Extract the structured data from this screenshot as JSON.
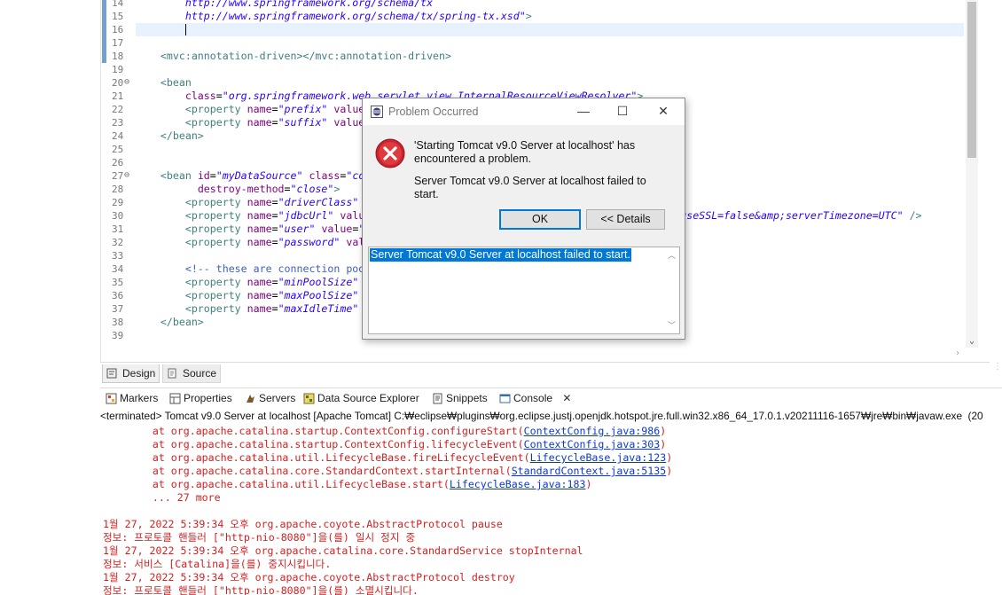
{
  "editor": {
    "lines": [
      {
        "n": "14",
        "mark": true,
        "fold": false,
        "html": "        <span class=\"val\">http://www.springframework.org/schema/tx</span>"
      },
      {
        "n": "15",
        "mark": true,
        "fold": false,
        "html": "        <span class=\"val\">http://www.springframework.org/schema/tx/spring-tx.xsd\"</span><span class=\"tag\">&gt;</span>"
      },
      {
        "n": "16",
        "mark": true,
        "fold": false,
        "cur": true,
        "html": "        <span class=\"caret\"></span>"
      },
      {
        "n": "17",
        "mark": true,
        "fold": false,
        "html": ""
      },
      {
        "n": "18",
        "mark": true,
        "fold": false,
        "html": "    <span class=\"tag\">&lt;mvc:annotation-driven&gt;&lt;/mvc:annotation-driven&gt;</span>"
      },
      {
        "n": "19",
        "mark": false,
        "fold": false,
        "html": ""
      },
      {
        "n": "20",
        "mark": false,
        "fold": true,
        "html": "    <span class=\"tag\">&lt;bean</span>"
      },
      {
        "n": "21",
        "mark": false,
        "fold": false,
        "html": "        <span class=\"attr\">class</span>=<span class=\"val\">\"org.springframework.web.servlet.view.InternalResourceViewResolver\"</span><span class=\"tag\">&gt;</span>"
      },
      {
        "n": "22",
        "mark": false,
        "fold": false,
        "html": "        <span class=\"tag\">&lt;property</span> <span class=\"attr\">name</span>=<span class=\"val\">\"prefix\"</span> <span class=\"attr\">value</span>"
      },
      {
        "n": "23",
        "mark": false,
        "fold": false,
        "html": "        <span class=\"tag\">&lt;property</span> <span class=\"attr\">name</span>=<span class=\"val\">\"suffix\"</span> <span class=\"attr\">value</span>"
      },
      {
        "n": "24",
        "mark": false,
        "fold": false,
        "html": "    <span class=\"tag\">&lt;/bean&gt;</span>"
      },
      {
        "n": "25",
        "mark": false,
        "fold": false,
        "html": ""
      },
      {
        "n": "26",
        "mark": false,
        "fold": false,
        "html": ""
      },
      {
        "n": "27",
        "mark": false,
        "fold": true,
        "html": "    <span class=\"tag\">&lt;bean</span> <span class=\"attr\">id</span>=<span class=\"val\">\"myDataSource\"</span> <span class=\"attr\">class</span>=<span class=\"val\">\"co</span>"
      },
      {
        "n": "28",
        "mark": false,
        "fold": false,
        "html": "          <span class=\"attr\">destroy-method</span>=<span class=\"val\">\"close\"</span><span class=\"tag\">&gt;</span>"
      },
      {
        "n": "29",
        "mark": false,
        "fold": false,
        "html": "        <span class=\"tag\">&lt;property</span> <span class=\"attr\">name</span>=<span class=\"val\">\"driverClass\"</span>"
      },
      {
        "n": "30",
        "mark": false,
        "fold": false,
        "html": "        <span class=\"tag\">&lt;property</span> <span class=\"attr\">name</span>=<span class=\"val\">\"jdbcUrl\"</span> <span class=\"attr\">valu</span>                                                  <span class=\"val\">?useSSL=false&amp;amp;serverTimezone=UTC\"</span> <span class=\"tag\">/&gt;</span>"
      },
      {
        "n": "31",
        "mark": false,
        "fold": false,
        "html": "        <span class=\"tag\">&lt;property</span> <span class=\"attr\">name</span>=<span class=\"val\">\"user\"</span> <span class=\"attr\">value</span>=<span class=\"val\">\"</span>"
      },
      {
        "n": "32",
        "mark": false,
        "fold": false,
        "html": "        <span class=\"tag\">&lt;property</span> <span class=\"attr\">name</span>=<span class=\"val\">\"password\"</span> <span class=\"attr\">val</span>"
      },
      {
        "n": "33",
        "mark": false,
        "fold": false,
        "html": ""
      },
      {
        "n": "34",
        "mark": false,
        "fold": false,
        "html": "        <span class=\"cmt\">&lt;!-- these are connection poo</span>"
      },
      {
        "n": "35",
        "mark": false,
        "fold": false,
        "html": "        <span class=\"tag\">&lt;property</span> <span class=\"attr\">name</span>=<span class=\"val\">\"minPoolSize\"</span>"
      },
      {
        "n": "36",
        "mark": false,
        "fold": false,
        "html": "        <span class=\"tag\">&lt;property</span> <span class=\"attr\">name</span>=<span class=\"val\">\"maxPoolSize\"</span>"
      },
      {
        "n": "37",
        "mark": false,
        "fold": false,
        "html": "        <span class=\"tag\">&lt;property</span> <span class=\"attr\">name</span>=<span class=\"val\">\"maxIdleTime\"</span>"
      },
      {
        "n": "38",
        "mark": false,
        "fold": false,
        "html": "    <span class=\"tag\">&lt;/bean&gt;</span>"
      },
      {
        "n": "39",
        "mark": false,
        "fold": false,
        "html": ""
      }
    ]
  },
  "editor_tabs": {
    "design": "Design",
    "source": "Source"
  },
  "view_tabs": {
    "markers": "Markers",
    "properties": "Properties",
    "servers": "Servers",
    "data_source_explorer": "Data Source Explorer",
    "snippets": "Snippets",
    "console": "Console"
  },
  "console": {
    "status": "<terminated> Tomcat v9.0 Server at localhost [Apache Tomcat] C:₩eclipse₩plugins₩org.eclipse.justj.openjdk.hotspot.jre.full.win32.x86_64_17.0.1.v20211116-1657₩jre₩bin₩javaw.exe  (20",
    "lines": [
      {
        "text": "        at org.apache.catalina.startup.ContextConfig.configureStart(",
        "link": "ContextConfig.java:986",
        "tail": ")"
      },
      {
        "text": "        at org.apache.catalina.startup.ContextConfig.lifecycleEvent(",
        "link": "ContextConfig.java:303",
        "tail": ")"
      },
      {
        "text": "        at org.apache.catalina.util.LifecycleBase.fireLifecycleEvent(",
        "link": "LifecycleBase.java:123",
        "tail": ")"
      },
      {
        "text": "        at org.apache.catalina.core.StandardContext.startInternal(",
        "link": "StandardContext.java:5135",
        "tail": ")"
      },
      {
        "text": "        at org.apache.catalina.util.LifecycleBase.start(",
        "link": "LifecycleBase.java:183",
        "tail": ")"
      },
      {
        "text": "        ... 27 more",
        "link": "",
        "tail": ""
      },
      {
        "text": "",
        "link": "",
        "tail": ""
      },
      {
        "text": "1월 27, 2022 5:39:34 오후 org.apache.coyote.AbstractProtocol pause",
        "link": "",
        "tail": ""
      },
      {
        "text": "정보: 프로토콜 핸들러 [\"http-nio-8080\"]을(를) 일시 정지 중",
        "link": "",
        "tail": ""
      },
      {
        "text": "1월 27, 2022 5:39:34 오후 org.apache.catalina.core.StandardService stopInternal",
        "link": "",
        "tail": ""
      },
      {
        "text": "정보: 서비스 [Catalina]을(를) 중지시킵니다.",
        "link": "",
        "tail": ""
      },
      {
        "text": "1월 27, 2022 5:39:34 오후 org.apache.coyote.AbstractProtocol destroy",
        "link": "",
        "tail": ""
      },
      {
        "text": "정보: 프로토콜 핸들러 [\"http-nio-8080\"]을(를) 소멸시킵니다.",
        "link": "",
        "tail": ""
      }
    ]
  },
  "dialog": {
    "title": "Problem Occurred",
    "message1": "'Starting Tomcat v9.0 Server at localhost' has encountered a problem.",
    "message2": "Server Tomcat v9.0 Server at localhost failed to start.",
    "ok_label": "OK",
    "details_label": "<< Details",
    "details_text": "Server Tomcat v9.0 Server at localhost failed to start."
  },
  "colors": {
    "error_red": "#d42020",
    "link_blue": "#0b38d4",
    "selection_blue": "#0078d7"
  }
}
